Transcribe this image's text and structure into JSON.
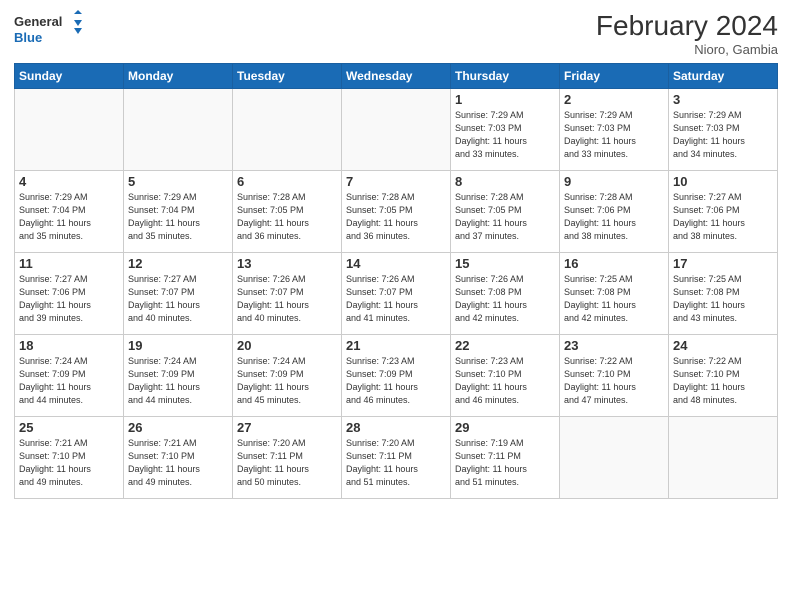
{
  "header": {
    "logo_line1": "General",
    "logo_line2": "Blue",
    "month": "February 2024",
    "location": "Nioro, Gambia"
  },
  "weekdays": [
    "Sunday",
    "Monday",
    "Tuesday",
    "Wednesday",
    "Thursday",
    "Friday",
    "Saturday"
  ],
  "weeks": [
    [
      {
        "day": "",
        "info": ""
      },
      {
        "day": "",
        "info": ""
      },
      {
        "day": "",
        "info": ""
      },
      {
        "day": "",
        "info": ""
      },
      {
        "day": "1",
        "info": "Sunrise: 7:29 AM\nSunset: 7:03 PM\nDaylight: 11 hours\nand 33 minutes."
      },
      {
        "day": "2",
        "info": "Sunrise: 7:29 AM\nSunset: 7:03 PM\nDaylight: 11 hours\nand 33 minutes."
      },
      {
        "day": "3",
        "info": "Sunrise: 7:29 AM\nSunset: 7:03 PM\nDaylight: 11 hours\nand 34 minutes."
      }
    ],
    [
      {
        "day": "4",
        "info": "Sunrise: 7:29 AM\nSunset: 7:04 PM\nDaylight: 11 hours\nand 35 minutes."
      },
      {
        "day": "5",
        "info": "Sunrise: 7:29 AM\nSunset: 7:04 PM\nDaylight: 11 hours\nand 35 minutes."
      },
      {
        "day": "6",
        "info": "Sunrise: 7:28 AM\nSunset: 7:05 PM\nDaylight: 11 hours\nand 36 minutes."
      },
      {
        "day": "7",
        "info": "Sunrise: 7:28 AM\nSunset: 7:05 PM\nDaylight: 11 hours\nand 36 minutes."
      },
      {
        "day": "8",
        "info": "Sunrise: 7:28 AM\nSunset: 7:05 PM\nDaylight: 11 hours\nand 37 minutes."
      },
      {
        "day": "9",
        "info": "Sunrise: 7:28 AM\nSunset: 7:06 PM\nDaylight: 11 hours\nand 38 minutes."
      },
      {
        "day": "10",
        "info": "Sunrise: 7:27 AM\nSunset: 7:06 PM\nDaylight: 11 hours\nand 38 minutes."
      }
    ],
    [
      {
        "day": "11",
        "info": "Sunrise: 7:27 AM\nSunset: 7:06 PM\nDaylight: 11 hours\nand 39 minutes."
      },
      {
        "day": "12",
        "info": "Sunrise: 7:27 AM\nSunset: 7:07 PM\nDaylight: 11 hours\nand 40 minutes."
      },
      {
        "day": "13",
        "info": "Sunrise: 7:26 AM\nSunset: 7:07 PM\nDaylight: 11 hours\nand 40 minutes."
      },
      {
        "day": "14",
        "info": "Sunrise: 7:26 AM\nSunset: 7:07 PM\nDaylight: 11 hours\nand 41 minutes."
      },
      {
        "day": "15",
        "info": "Sunrise: 7:26 AM\nSunset: 7:08 PM\nDaylight: 11 hours\nand 42 minutes."
      },
      {
        "day": "16",
        "info": "Sunrise: 7:25 AM\nSunset: 7:08 PM\nDaylight: 11 hours\nand 42 minutes."
      },
      {
        "day": "17",
        "info": "Sunrise: 7:25 AM\nSunset: 7:08 PM\nDaylight: 11 hours\nand 43 minutes."
      }
    ],
    [
      {
        "day": "18",
        "info": "Sunrise: 7:24 AM\nSunset: 7:09 PM\nDaylight: 11 hours\nand 44 minutes."
      },
      {
        "day": "19",
        "info": "Sunrise: 7:24 AM\nSunset: 7:09 PM\nDaylight: 11 hours\nand 44 minutes."
      },
      {
        "day": "20",
        "info": "Sunrise: 7:24 AM\nSunset: 7:09 PM\nDaylight: 11 hours\nand 45 minutes."
      },
      {
        "day": "21",
        "info": "Sunrise: 7:23 AM\nSunset: 7:09 PM\nDaylight: 11 hours\nand 46 minutes."
      },
      {
        "day": "22",
        "info": "Sunrise: 7:23 AM\nSunset: 7:10 PM\nDaylight: 11 hours\nand 46 minutes."
      },
      {
        "day": "23",
        "info": "Sunrise: 7:22 AM\nSunset: 7:10 PM\nDaylight: 11 hours\nand 47 minutes."
      },
      {
        "day": "24",
        "info": "Sunrise: 7:22 AM\nSunset: 7:10 PM\nDaylight: 11 hours\nand 48 minutes."
      }
    ],
    [
      {
        "day": "25",
        "info": "Sunrise: 7:21 AM\nSunset: 7:10 PM\nDaylight: 11 hours\nand 49 minutes."
      },
      {
        "day": "26",
        "info": "Sunrise: 7:21 AM\nSunset: 7:10 PM\nDaylight: 11 hours\nand 49 minutes."
      },
      {
        "day": "27",
        "info": "Sunrise: 7:20 AM\nSunset: 7:11 PM\nDaylight: 11 hours\nand 50 minutes."
      },
      {
        "day": "28",
        "info": "Sunrise: 7:20 AM\nSunset: 7:11 PM\nDaylight: 11 hours\nand 51 minutes."
      },
      {
        "day": "29",
        "info": "Sunrise: 7:19 AM\nSunset: 7:11 PM\nDaylight: 11 hours\nand 51 minutes."
      },
      {
        "day": "",
        "info": ""
      },
      {
        "day": "",
        "info": ""
      }
    ]
  ]
}
